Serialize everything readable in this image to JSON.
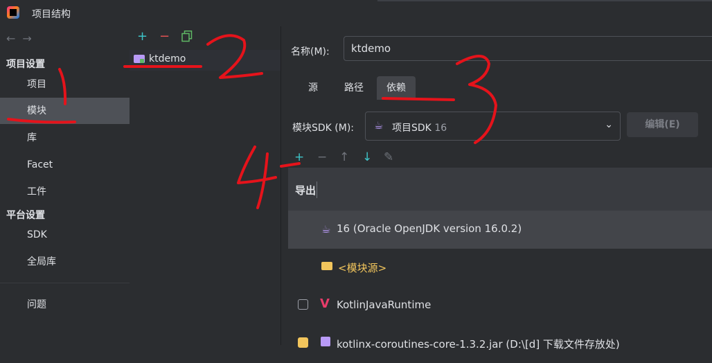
{
  "window": {
    "title": "项目结构"
  },
  "nav": {
    "back": "←",
    "forward": "→",
    "project_settings_header": "项目设置",
    "platform_settings_header": "平台设置",
    "items": [
      "项目",
      "模块",
      "库",
      "Facet",
      "工件"
    ],
    "platform_items": [
      "SDK",
      "全局库"
    ],
    "problems": "问题",
    "selected": "模块"
  },
  "modules": {
    "toolbar": {
      "add": "+",
      "remove": "−",
      "copy": "copy-icon"
    },
    "list": [
      "ktdemo"
    ]
  },
  "detail": {
    "name_label": "名称(M):",
    "name_value": "ktdemo",
    "tabs": [
      "源",
      "路径",
      "依赖"
    ],
    "active_tab": "依赖",
    "sdk_label": "模块SDK (M):",
    "sdk_value": "项目SDK",
    "sdk_version": "16",
    "edit_button": "编辑(E)",
    "dep_toolbar": [
      "+",
      "−",
      "↑",
      "↓",
      "✎"
    ],
    "table_header": "导出",
    "rows": [
      {
        "text": "16 (Oracle OpenJDK version 16.0.2)",
        "selected": true
      },
      {
        "text": "<模块源>"
      },
      {
        "text": "KotlinJavaRuntime",
        "checked": false
      },
      {
        "text": "kotlinx-coroutines-core-1.3.2.jar (D:\\[d] 下载文件存放处)",
        "checked": true
      }
    ]
  },
  "annotations": [
    "1",
    "2",
    "3",
    "4"
  ],
  "colors": {
    "accent_add": "#3ec5c9",
    "remove": "#e55353",
    "annotation": "#e5131b",
    "selected_nav": "#4e5157"
  }
}
